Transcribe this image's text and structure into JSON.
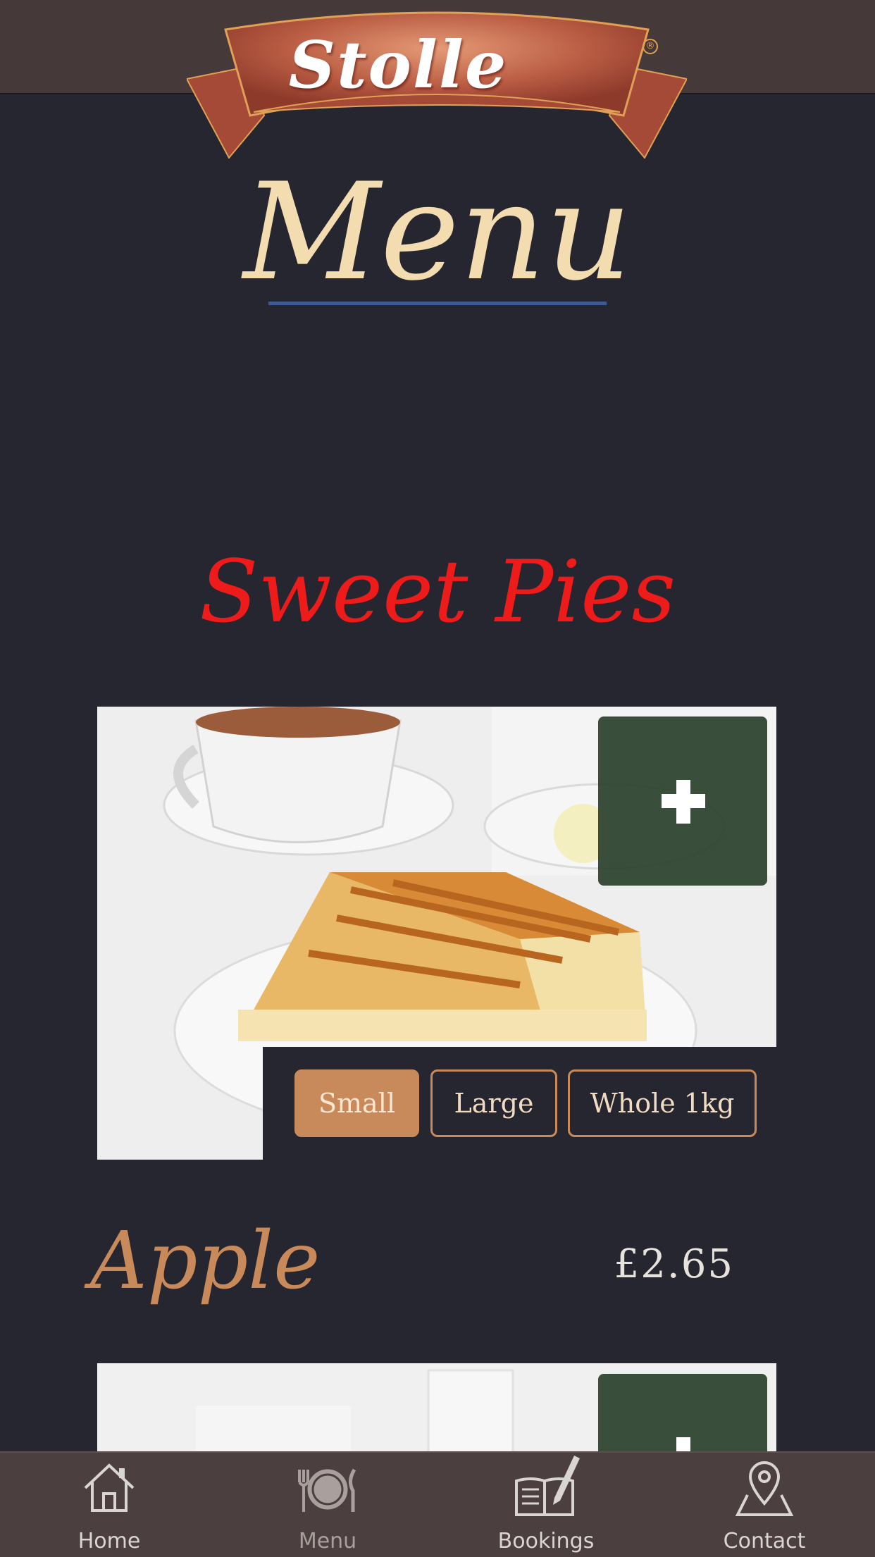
{
  "header": {
    "logo_text": "Stolle",
    "logo_mark": "®"
  },
  "page": {
    "title": "Menu"
  },
  "section": {
    "title": "Sweet Pies"
  },
  "items": [
    {
      "name": "Apple",
      "price": "£2.65",
      "image_icon": "apple-pie-photo",
      "add_icon": "plus-icon",
      "sizes": [
        {
          "label": "Small",
          "selected": true
        },
        {
          "label": "Large",
          "selected": false
        },
        {
          "label": "Whole 1kg",
          "selected": false
        }
      ]
    },
    {
      "image_icon": "pie-photo",
      "add_icon": "plus-icon"
    }
  ],
  "tabs": [
    {
      "label": "Home",
      "icon": "home-icon",
      "active": false
    },
    {
      "label": "Menu",
      "icon": "plate-cutlery-icon",
      "active": true
    },
    {
      "label": "Bookings",
      "icon": "book-pen-icon",
      "active": false
    },
    {
      "label": "Contact",
      "icon": "location-pin-icon",
      "active": false
    }
  ],
  "colors": {
    "background": "#262630",
    "header_bar": "#453a39",
    "title": "#f3dcb0",
    "section_title": "#ee1b1b",
    "accent": "#c98a5b",
    "add_button": "#2f4531",
    "title_rule": "#3d5a95",
    "tab_bar": "#4b403f"
  }
}
